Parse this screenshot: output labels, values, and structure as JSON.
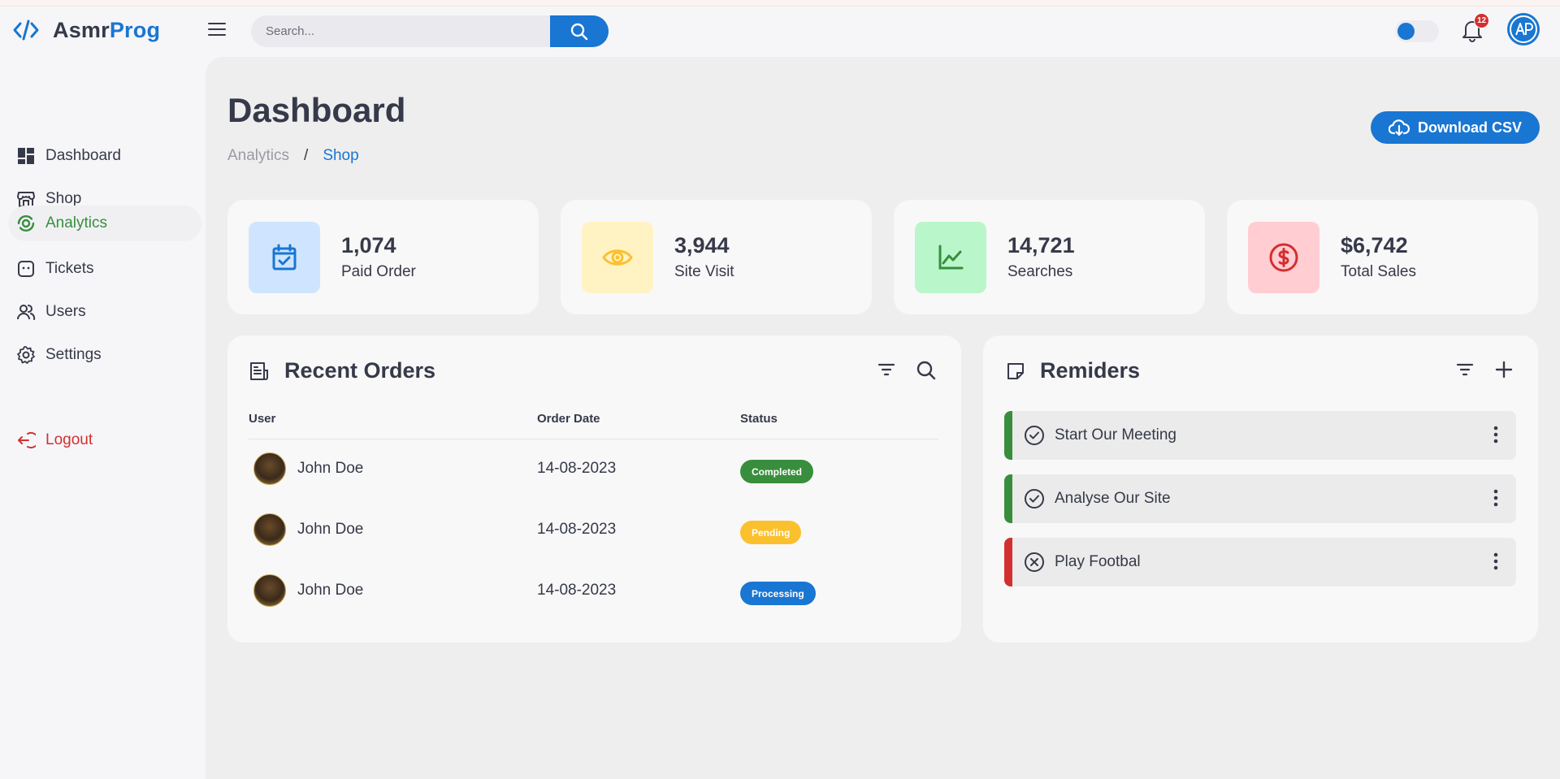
{
  "brand": {
    "name_part1": "Asmr",
    "name_part2": "Prog"
  },
  "search": {
    "placeholder": "Search..."
  },
  "notifications": {
    "count": "12"
  },
  "sidebar": {
    "items": [
      {
        "label": "Dashboard",
        "icon": "dashboard-icon"
      },
      {
        "label": "Shop",
        "icon": "shop-icon"
      },
      {
        "label": "Analytics",
        "icon": "analytics-icon",
        "active": true
      },
      {
        "label": "Tickets",
        "icon": "ticket-icon"
      },
      {
        "label": "Users",
        "icon": "users-icon"
      },
      {
        "label": "Settings",
        "icon": "gear-icon"
      }
    ],
    "logout": "Logout"
  },
  "header": {
    "title": "Dashboard",
    "breadcrumb": [
      "Analytics",
      "/",
      "Shop"
    ],
    "download_label": "Download CSV"
  },
  "stats": [
    {
      "value": "1,074",
      "label": "Paid Order",
      "icon": "calendar-check-icon",
      "color": "#1976d2",
      "bg": "#cfe5ff"
    },
    {
      "value": "3,944",
      "label": "Site Visit",
      "icon": "eye-icon",
      "color": "#fbc02d",
      "bg": "#fff3c4"
    },
    {
      "value": "14,721",
      "label": "Searches",
      "icon": "chart-line-icon",
      "color": "#388e3c",
      "bg": "#b9f6ca"
    },
    {
      "value": "$6,742",
      "label": "Total Sales",
      "icon": "dollar-icon",
      "color": "#d32f2f",
      "bg": "#ffcdd2"
    }
  ],
  "orders": {
    "title": "Recent Orders",
    "columns": [
      "User",
      "Order Date",
      "Status"
    ],
    "rows": [
      {
        "user": "John Doe",
        "date": "14-08-2023",
        "status": "Completed",
        "color": "#388e3c"
      },
      {
        "user": "John Doe",
        "date": "14-08-2023",
        "status": "Pending",
        "color": "#fbc02d"
      },
      {
        "user": "John Doe",
        "date": "14-08-2023",
        "status": "Processing",
        "color": "#1976d2"
      }
    ]
  },
  "reminders": {
    "title": "Remiders",
    "items": [
      {
        "label": "Start Our Meeting",
        "state": "done",
        "color": "#388e3c"
      },
      {
        "label": "Analyse Our Site",
        "state": "done",
        "color": "#388e3c"
      },
      {
        "label": "Play Footbal",
        "state": "cancelled",
        "color": "#d32f2f"
      }
    ]
  },
  "colors": {
    "primary": "#1976d2",
    "success": "#388e3c",
    "warning": "#fbc02d",
    "danger": "#d32f2f",
    "text": "#363949"
  }
}
